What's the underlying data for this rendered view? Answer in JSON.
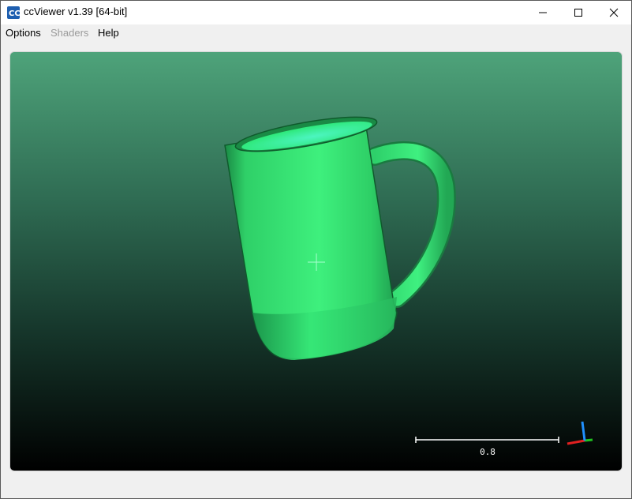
{
  "window": {
    "title": "ccViewer v1.39 [64-bit]",
    "controls": [
      "minimize-icon",
      "maximize-icon",
      "close-icon"
    ]
  },
  "menu": {
    "items": [
      {
        "label": "Options",
        "enabled": true
      },
      {
        "label": "Shaders",
        "enabled": false
      },
      {
        "label": "Help",
        "enabled": true
      }
    ]
  },
  "viewer": {
    "scale_value": "0.8",
    "background_top": "#4ea37a",
    "background_bottom": "#000000",
    "model_color": "#33ee77",
    "axis_colors": {
      "x": "#e02020",
      "y": "#20c020",
      "z": "#2090ff"
    }
  }
}
